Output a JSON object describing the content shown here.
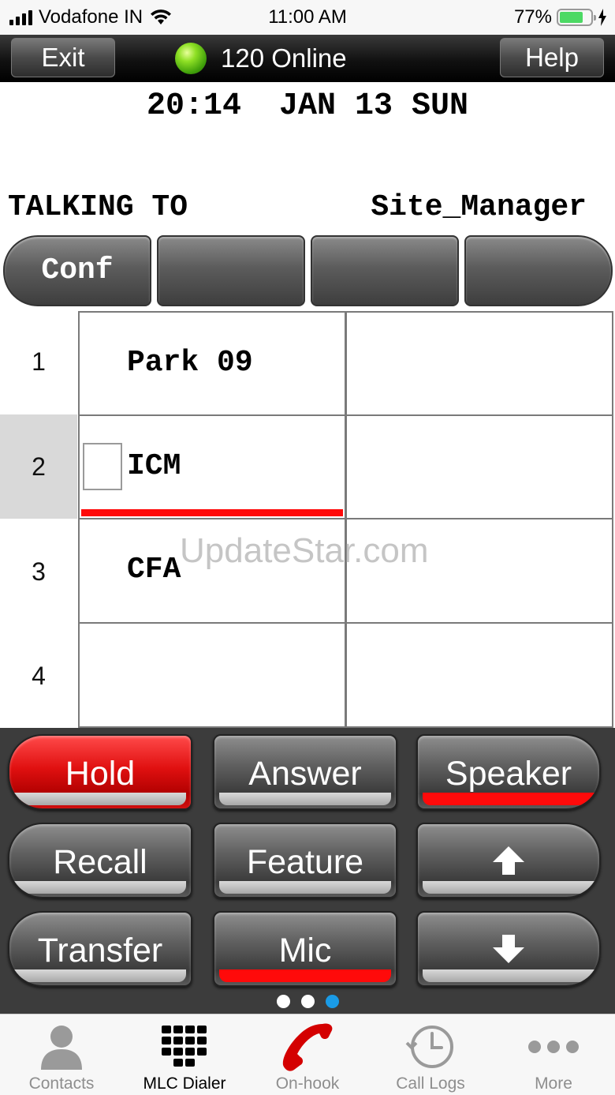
{
  "status_bar": {
    "carrier": "Vodafone IN",
    "time": "11:00 AM",
    "battery": "77%",
    "battery_level": 0.77
  },
  "header": {
    "exit_label": "Exit",
    "status_text": "120 Online",
    "help_label": "Help",
    "status_color": "#5cc41a"
  },
  "display": {
    "datetime": "20:14  JAN 13 SUN",
    "talking_label": "TALKING TO",
    "talking_name": "Site_Manager"
  },
  "softkeys": [
    "Conf",
    "",
    "",
    ""
  ],
  "lines": [
    {
      "number": "1",
      "left": "Park 09",
      "right": ""
    },
    {
      "number": "2",
      "left": "ICM",
      "right": ""
    },
    {
      "number": "3",
      "left": "CFA",
      "right": ""
    },
    {
      "number": "4",
      "left": "",
      "right": ""
    }
  ],
  "watermark": "UpdateStar.com",
  "keypad": {
    "hold": "Hold",
    "answer": "Answer",
    "speaker": "Speaker",
    "recall": "Recall",
    "feature": "Feature",
    "up": "up-arrow-icon",
    "transfer": "Transfer",
    "mic": "Mic",
    "down": "down-arrow-icon"
  },
  "pager": {
    "pages": 3,
    "active": 3
  },
  "tabs": [
    {
      "label": "Contacts",
      "icon": "person-icon"
    },
    {
      "label": "MLC Dialer",
      "icon": "dialpad-icon"
    },
    {
      "label": "On-hook",
      "icon": "phone-handset-icon"
    },
    {
      "label": "Call Logs",
      "icon": "clock-icon"
    },
    {
      "label": "More",
      "icon": "more-dots-icon"
    }
  ],
  "colors": {
    "accent_red": "#ff0a0a",
    "active_dot": "#1a9be6",
    "battery_green": "#4cd964",
    "onhook_red": "#d40000"
  }
}
